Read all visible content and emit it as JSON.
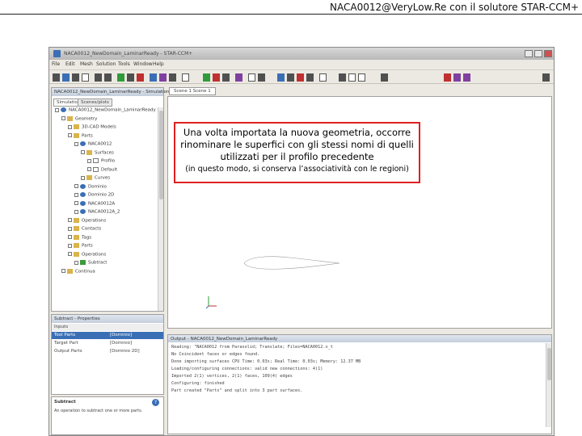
{
  "slide": {
    "title": "NACA0012@VeryLow.Re con il solutore STAR-CCM+"
  },
  "window": {
    "title": "NACA0012_NewDomain_LaminarReady - STAR-CCM+"
  },
  "menubar": {
    "items": [
      "File",
      "Edit",
      "Mesh",
      "Solution",
      "Tools",
      "Window",
      "Help"
    ]
  },
  "simulation_panel": {
    "header": "NACA0012_NewDomain_LaminarReady - Simulation",
    "tabs": [
      "Simulation",
      "Scenes/plots"
    ],
    "tree": [
      {
        "label": "NACA0012_NewDomain_LaminarReady",
        "depth": 0,
        "icon": "sim"
      },
      {
        "label": "Geometry",
        "depth": 1,
        "icon": "folder"
      },
      {
        "label": "3D-CAD Models",
        "depth": 2,
        "icon": "folder"
      },
      {
        "label": "Parts",
        "depth": 2,
        "icon": "folder"
      },
      {
        "label": "NACA0012",
        "depth": 3,
        "icon": "part"
      },
      {
        "label": "Surfaces",
        "depth": 4,
        "icon": "folder"
      },
      {
        "label": "Profilo",
        "depth": 5,
        "icon": "surface"
      },
      {
        "label": "Default",
        "depth": 5,
        "icon": "surface"
      },
      {
        "label": "Curves",
        "depth": 4,
        "icon": "folder"
      },
      {
        "label": "Dominio",
        "depth": 3,
        "icon": "part"
      },
      {
        "label": "Dominio 2D",
        "depth": 3,
        "icon": "part"
      },
      {
        "label": "NACA0012A",
        "depth": 3,
        "icon": "part"
      },
      {
        "label": "NACA0012A_2",
        "depth": 3,
        "icon": "part"
      },
      {
        "label": "Operations",
        "depth": 2,
        "icon": "folder"
      },
      {
        "label": "Contacts",
        "depth": 2,
        "icon": "folder"
      },
      {
        "label": "Tags",
        "depth": 2,
        "icon": "folder"
      },
      {
        "label": "Parts",
        "depth": 2,
        "icon": "folder"
      },
      {
        "label": "Operations",
        "depth": 2,
        "icon": "folder"
      },
      {
        "label": "Subtract",
        "depth": 3,
        "icon": "operation"
      },
      {
        "label": "Continua",
        "depth": 1,
        "icon": "folder"
      }
    ]
  },
  "properties_panel": {
    "header": "Subtract - Properties",
    "group": "Inputs",
    "rows": [
      {
        "name": "Tool Parts",
        "value": "[Dominio]"
      },
      {
        "name": "Target Part",
        "value": "[Dominio]"
      },
      {
        "name": "Output Parts",
        "value": "[Dominio 2D]"
      }
    ],
    "footer_title": "Subtract",
    "footer_text": "An operation to subtract one or more parts."
  },
  "scene": {
    "tab_label": "Scene 1 Scene 1",
    "callout": {
      "main": "Una volta importata la nuova geometria, occorre rinominare le superfici con gli stessi nomi di quelli utilizzati per il profilo precedente",
      "sub": "(in questo modo, si conserva l’associatività con le regioni)"
    }
  },
  "output_panel": {
    "header": "Output - NACA0012_NewDomain_LaminarReady",
    "lines": [
      "Reading: \"NACA0012 from Parasolid; Translate; Files=NACA0012.x_t",
      "No Coincident faces or edges found.",
      "Done importing surfaces CPU Time: 0.03s; Real Time: 0.03s; Memory: 12.37 MB",
      "Loading/configuring connections: valid new connections: 4(1)",
      "  Imported 2(1) vertices, 2(1) faces, 109(4) edges",
      "Configuring: finished",
      "Part created \"Parts\" and split into 3 part surfaces."
    ]
  },
  "colors": {
    "callout_border": "#e02020",
    "accent": "#3a6fb5"
  }
}
